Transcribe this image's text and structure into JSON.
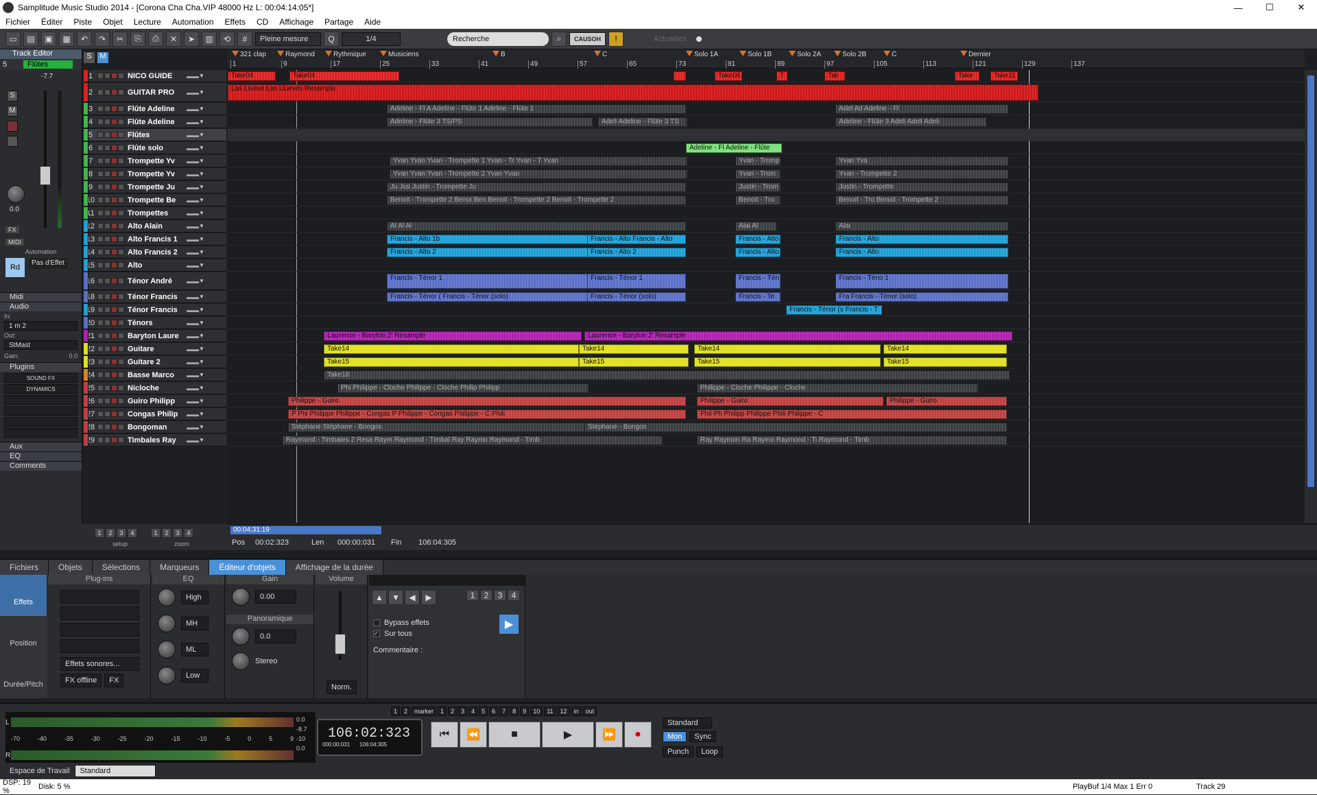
{
  "window": {
    "title": "Samplitude Music Studio 2014 - [Corona Cha Cha.VIP   48000 Hz L: 00:04:14:05*]",
    "min": "—",
    "max": "☐",
    "close": "✕"
  },
  "menu": [
    "Fichier",
    "Éditer",
    "Piste",
    "Objet",
    "Lecture",
    "Automation",
    "Effets",
    "CD",
    "Affichage",
    "Partage",
    "Aide"
  ],
  "toolbar": {
    "mode": "Pleine mesure",
    "quant": "1/4",
    "search_placeholder": "Recherche",
    "news": "Actualités",
    "brand": "CAUSOH"
  },
  "track_editor": {
    "label": "Track Editor",
    "track_num": "5",
    "track_name": "Flûtes",
    "level": "-7.7",
    "pan": "0.0",
    "fx": "FX",
    "midi": "MIDI",
    "automation": "Automation",
    "read": "Rd",
    "no_effect": "Pas d'Effet"
  },
  "left_sections": {
    "midi": "Midi",
    "audio": "Audio",
    "in_label": "In:",
    "in_value": "1 m 2",
    "out_label": "Out:",
    "out_value": "StMast",
    "gain_label": "Gain:",
    "gain_value": "0.0",
    "plugins": "Plugins",
    "sound_fx": "SOUND FX",
    "dynamics": "DYNAMICS",
    "aux": "Aux",
    "eq": "EQ",
    "comments": "Comments",
    "setup": "setup",
    "zoom": "zoom"
  },
  "markers": [
    {
      "label": "321 clap"
    },
    {
      "label": "Raymond"
    },
    {
      "label": "Rythmique"
    },
    {
      "label": "Musiciens"
    },
    {
      "label": "B"
    },
    {
      "label": "C"
    },
    {
      "label": "Solo 1A"
    },
    {
      "label": "Solo 1B"
    },
    {
      "label": "Solo 2A"
    },
    {
      "label": "Solo 2B"
    },
    {
      "label": "C"
    },
    {
      "label": "Dernier"
    }
  ],
  "bars": [
    "1",
    "9",
    "17",
    "25",
    "33",
    "41",
    "49",
    "57",
    "65",
    "73",
    "81",
    "89",
    "97",
    "105",
    "113",
    "121",
    "129",
    "137"
  ],
  "tracks": [
    {
      "num": "1",
      "name": "NICO GUIDE",
      "color": "#e02020"
    },
    {
      "num": "2",
      "name": "GUITAR PRO",
      "color": "#e02020"
    },
    {
      "num": "3",
      "name": "Flûte Adeline",
      "color": "#3cb84a"
    },
    {
      "num": "4",
      "name": "Flûte Adeline",
      "color": "#3cb84a"
    },
    {
      "num": "5",
      "name": "Flûtes",
      "color": "#3cb84a"
    },
    {
      "num": "6",
      "name": "Flûte solo",
      "color": "#3cb84a"
    },
    {
      "num": "7",
      "name": "Trompette Yv",
      "color": "#3cb84a"
    },
    {
      "num": "8",
      "name": "Trompette Yv",
      "color": "#3cb84a"
    },
    {
      "num": "9",
      "name": "Trompette Ju",
      "color": "#3cb84a"
    },
    {
      "num": "10",
      "name": "Trompette Be",
      "color": "#3cb84a"
    },
    {
      "num": "11",
      "name": "Trompettes",
      "color": "#3cb84a"
    },
    {
      "num": "12",
      "name": "Alto Alain",
      "color": "#1ea0d8"
    },
    {
      "num": "13",
      "name": "Alto Francis 1",
      "color": "#1ea0d8"
    },
    {
      "num": "14",
      "name": "Alto Francis 2",
      "color": "#1ea0d8"
    },
    {
      "num": "15",
      "name": "Alto",
      "color": "#1ea0d8"
    },
    {
      "num": "16",
      "name": "Ténor André",
      "color": "#5a70c8"
    },
    {
      "num": "18",
      "name": "Ténor Francis",
      "color": "#5a70c8"
    },
    {
      "num": "19",
      "name": "Ténor Francis",
      "color": "#1ea0d8"
    },
    {
      "num": "20",
      "name": "Ténors",
      "color": "#5a70c8"
    },
    {
      "num": "21",
      "name": "Baryton Laure",
      "color": "#b020b0"
    },
    {
      "num": "22",
      "name": "Guitare",
      "color": "#e0e020"
    },
    {
      "num": "23",
      "name": "Guitare 2",
      "color": "#e0e020"
    },
    {
      "num": "24",
      "name": "Basse Marco",
      "color": "#e08020"
    },
    {
      "num": "25",
      "name": "Nicloche",
      "color": "#c04040"
    },
    {
      "num": "26",
      "name": "Guiro Philipp",
      "color": "#c04040"
    },
    {
      "num": "27",
      "name": "Congas Philip",
      "color": "#c04040"
    },
    {
      "num": "28",
      "name": "Bongoman",
      "color": "#c04040"
    },
    {
      "num": "29",
      "name": "Timbales Ray",
      "color": "#c04040"
    }
  ],
  "clips": [
    {
      "lane": 0,
      "label": "Take04",
      "color": "#e02020"
    },
    {
      "lane": 0,
      "label": "Take04",
      "color": "#e02020"
    },
    {
      "lane": 0,
      "label": "",
      "color": "#e02020"
    },
    {
      "lane": 0,
      "label": "Take06",
      "color": "#e02020"
    },
    {
      "lane": 0,
      "label": "T",
      "color": "#e02020"
    },
    {
      "lane": 0,
      "label": "Tak",
      "color": "#e02020"
    },
    {
      "lane": 0,
      "label": "Take",
      "color": "#e02020"
    },
    {
      "lane": 0,
      "label": "Take11",
      "color": "#e02020"
    },
    {
      "lane": 1,
      "label": "Las Llueve    Las Llueves  Resample",
      "color": "#d01818"
    },
    {
      "lane": 2,
      "label": "Adeline - Fl   A    Adeline - Flûte 1   Adeline - Flûte 1",
      "color": "#3a3d40"
    },
    {
      "lane": 2,
      "label": "Adel   Ad   Adeline - Fl",
      "color": "#3a3d40"
    },
    {
      "lane": 3,
      "label": "Adeline - Flûte 3   TS/PS",
      "color": "#3a3d40"
    },
    {
      "lane": 3,
      "label": "Adeli   Adeline - Flûte 3   TS",
      "color": "#3a3d40"
    },
    {
      "lane": 3,
      "label": "Adeline - Flûte 3   Adeli   Adeli   Adeli",
      "color": "#3a3d40"
    },
    {
      "lane": 5,
      "label": "Adeline - Fl   Adeline - Flûte",
      "color": "#7ce07c"
    },
    {
      "lane": 6,
      "label": "Yvan   Yvan   Yvan - Trompette 1   Yvan - Tr   Yvan - T   Yvan",
      "color": "#3a3d40"
    },
    {
      "lane": 6,
      "label": "Yvan - Tromp",
      "color": "#3a3d40"
    },
    {
      "lane": 6,
      "label": "Yvan   Yva",
      "color": "#3a3d40"
    },
    {
      "lane": 7,
      "label": "Yvan   Yvan   Yvan - Trompette 2   Yvan   Yvan",
      "color": "#3a3d40"
    },
    {
      "lane": 7,
      "label": "Yvan - Trom",
      "color": "#3a3d40"
    },
    {
      "lane": 7,
      "label": "Yvan - Trompette 2",
      "color": "#3a3d40"
    },
    {
      "lane": 8,
      "label": "Ju   Jus   Justin - Trompette   Ju",
      "color": "#3a3d40"
    },
    {
      "lane": 8,
      "label": "Justin - Trom",
      "color": "#3a3d40"
    },
    {
      "lane": 8,
      "label": "Justin - Trompette",
      "color": "#3a3d40"
    },
    {
      "lane": 9,
      "label": "Benoit - Trompette 2   Benoi   Ben   Benoit - Trompette 2   Benoit - Trompette 2",
      "color": "#3a3d40"
    },
    {
      "lane": 9,
      "label": "Benoit - Tro",
      "color": "#3a3d40"
    },
    {
      "lane": 9,
      "label": "Benoit - Tro   Benoit - Trompette 2",
      "color": "#3a3d40"
    },
    {
      "lane": 11,
      "label": "Al   Al   Al",
      "color": "#3a3d40"
    },
    {
      "lane": 11,
      "label": "Alai   Al",
      "color": "#3a3d40"
    },
    {
      "lane": 11,
      "label": "Alai",
      "color": "#3a3d40"
    },
    {
      "lane": 12,
      "label": "Francis - Alto 1b",
      "color": "#1ea0d8"
    },
    {
      "lane": 12,
      "label": "Francis - Alto   Francis - Alto",
      "color": "#1ea0d8"
    },
    {
      "lane": 12,
      "label": "Francis - Alto",
      "color": "#1ea0d8"
    },
    {
      "lane": 12,
      "label": "Francis - Alto",
      "color": "#1ea0d8"
    },
    {
      "lane": 13,
      "label": "Francis - Alto 2",
      "color": "#1ea0d8"
    },
    {
      "lane": 13,
      "label": "Francis - Alto 2",
      "color": "#1ea0d8"
    },
    {
      "lane": 13,
      "label": "Francis - Alto",
      "color": "#1ea0d8"
    },
    {
      "lane": 13,
      "label": "Francis - Alto",
      "color": "#1ea0d8"
    },
    {
      "lane": 15,
      "label": "Francis - Ténor 1",
      "color": "#5a70c8"
    },
    {
      "lane": 15,
      "label": "Francis - Ténor 1",
      "color": "#5a70c8"
    },
    {
      "lane": 15,
      "label": "Francis - Tén",
      "color": "#5a70c8"
    },
    {
      "lane": 15,
      "label": "Francis - Téno   1",
      "color": "#5a70c8"
    },
    {
      "lane": 16,
      "label": "Francis - Ténor (   Francis - Ténor (solo)",
      "color": "#5a70c8"
    },
    {
      "lane": 16,
      "label": "Francis - Ténor (solo)",
      "color": "#5a70c8"
    },
    {
      "lane": 16,
      "label": "Francis - Te",
      "color": "#5a70c8"
    },
    {
      "lane": 16,
      "label": "Fra   Francis - Ténor (solo)",
      "color": "#5a70c8"
    },
    {
      "lane": 17,
      "label": "Francis - Ténor (s   Francis - T",
      "color": "#1ea0d8"
    },
    {
      "lane": 19,
      "label": "Laurence - Baryton 2' Resample",
      "color": "#b020b0"
    },
    {
      "lane": 19,
      "label": "Laurence - Baryton 2' Resample",
      "color": "#b020b0"
    },
    {
      "lane": 20,
      "label": "Take14",
      "color": "#e0e020"
    },
    {
      "lane": 20,
      "label": "Take14",
      "color": "#e0e020"
    },
    {
      "lane": 20,
      "label": "Take14",
      "color": "#e0e020"
    },
    {
      "lane": 20,
      "label": "Take14",
      "color": "#e0e020"
    },
    {
      "lane": 21,
      "label": "Take15",
      "color": "#e0e020"
    },
    {
      "lane": 21,
      "label": "Take15",
      "color": "#e0e020"
    },
    {
      "lane": 21,
      "label": "Take15",
      "color": "#e0e020"
    },
    {
      "lane": 21,
      "label": "Take15",
      "color": "#e0e020"
    },
    {
      "lane": 22,
      "label": "Take18",
      "color": "#3a3d40"
    },
    {
      "lane": 23,
      "label": "Phi   Philippe - Cloche   Philippe - Cloche   Philip   Philipp",
      "color": "#3a3d40"
    },
    {
      "lane": 23,
      "label": "Philippe - Cloche   Philippe - Cloche",
      "color": "#3a3d40"
    },
    {
      "lane": 24,
      "label": "Philippe - Guiro",
      "color": "#c04040"
    },
    {
      "lane": 24,
      "label": "Philippe - Guiro",
      "color": "#c04040"
    },
    {
      "lane": 24,
      "label": "Philippe - Guiro",
      "color": "#c04040"
    },
    {
      "lane": 25,
      "label": "P   Phi   Philippe   Philippe - Congas   P   Philippe - Congas   Philippe - C   Phili",
      "color": "#c04040"
    },
    {
      "lane": 25,
      "label": "Phil   Ph   Philipp   Philippe   Phili   Philippe - C",
      "color": "#c04040"
    },
    {
      "lane": 26,
      "label": "Stéphane   Stéphane - Bongos",
      "color": "#3a3d40"
    },
    {
      "lane": 26,
      "label": "Stéphane - Bongos",
      "color": "#3a3d40"
    },
    {
      "lane": 27,
      "label": "Raymond - Timbales 2   Resa   Raym   Raymond - Timbal   Ray   Raymo   Raymond - Timb",
      "color": "#3a3d40"
    },
    {
      "lane": 27,
      "label": "Ray   Raymon   Ra   Raymo   Raymond - Ti   Raymond - Timb",
      "color": "#3a3d40"
    }
  ],
  "position": {
    "scroll_time": "00:04:31:19",
    "pos_label": "Pos",
    "pos": "00:02:323",
    "len_label": "Len",
    "len": "000:00:031",
    "fin_label": "Fin",
    "fin": "106:04:305"
  },
  "bottom_tabs": [
    "Fichiers",
    "Objets",
    "Sélections",
    "Marqueurs",
    "Éditeur d'objets",
    "Affichage de la durée"
  ],
  "editor": {
    "effects": "Effets",
    "position": "Position",
    "duration": "Durée/Pitch",
    "plugins": "Plug-ins",
    "eq": "EQ",
    "gain": "Gain",
    "volume": "Volume",
    "eq_bands": [
      "High",
      "MH",
      "ML",
      "Low"
    ],
    "gain_value": "0.00",
    "pan_label": "Panoramique",
    "pan_value": "0.0",
    "stereo": "Stereo",
    "norm": "Norm.",
    "sound_effects": "Effets sonores...",
    "fx_offline": "FX offline",
    "fx": "FX",
    "bypass": "Bypass effets",
    "all": "Sur tous",
    "comment": "Commentaire :",
    "pages": [
      "1",
      "2",
      "3",
      "4"
    ]
  },
  "transport": {
    "timecode": "106:02:323",
    "tc_l": "000:00:031",
    "tc_e": "106:04:305",
    "standard": "Standard",
    "mon": "Mon",
    "sync": "Sync",
    "punch": "Punch",
    "loop": "Loop",
    "marker": "marker",
    "in": "in",
    "out": "out",
    "meter_scale": [
      "-70",
      "-40",
      "-35",
      "-30",
      "-25",
      "-20",
      "-15",
      "-10",
      "-5",
      "0",
      "5",
      "9"
    ],
    "peak": [
      "0.0",
      "-8.7",
      "-10",
      "0.0"
    ]
  },
  "workspace": {
    "label": "Espace de Travail",
    "value": "Standard"
  },
  "status": {
    "dsp": "DSP: 19 %",
    "disk": "Disk:  5 %",
    "playbuf": "PlayBuf 1/4  Max 1  Err 0",
    "track": "Track 29"
  }
}
